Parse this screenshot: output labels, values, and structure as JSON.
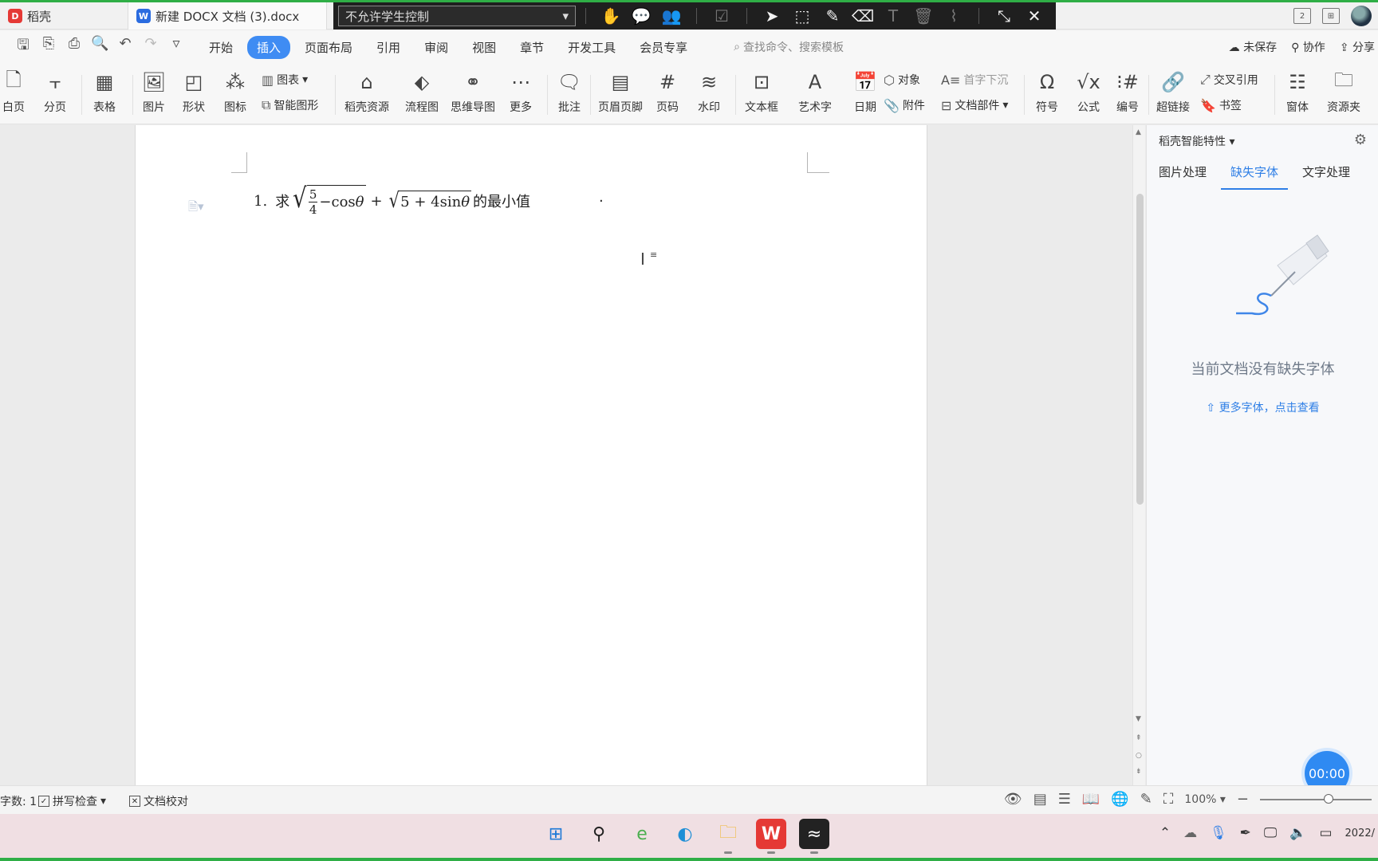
{
  "tabs": [
    {
      "label": "稻壳"
    },
    {
      "label": "新建 DOCX 文档 (3).docx"
    }
  ],
  "overlay": {
    "select_value": "不允许学生控制"
  },
  "menu": {
    "items": [
      "开始",
      "插入",
      "页面布局",
      "引用",
      "审阅",
      "视图",
      "章节",
      "开发工具",
      "会员专享"
    ],
    "active": "插入",
    "search_placeholder": "查找命令、搜索模板",
    "unsaved": "未保存",
    "collab": "协作",
    "share": "分享"
  },
  "ribbon": {
    "blank_page": "白页",
    "page_break": "分页",
    "table": "表格",
    "picture": "图片",
    "shape": "形状",
    "icon": "图标",
    "chart": "图表",
    "smart_shape": "智能图形",
    "daoke_res": "稻壳资源",
    "flowchart": "流程图",
    "mindmap": "思维导图",
    "more": "更多",
    "comment": "批注",
    "header_footer": "页眉页脚",
    "page_number": "页码",
    "watermark": "水印",
    "textbox": "文本框",
    "wordart": "艺术字",
    "date": "日期",
    "object": "对象",
    "attachment": "附件",
    "drop_cap": "首字下沉",
    "doc_parts": "文档部件",
    "symbol": "符号",
    "formula": "公式",
    "numbering": "编号",
    "hyperlink": "超链接",
    "cross_ref": "交叉引用",
    "bookmark": "书签",
    "form": "窗体",
    "resource": "资源夹"
  },
  "document": {
    "item_number": "1.",
    "prefix": "求",
    "frac_num": "5",
    "frac_den": "4",
    "term1": "−cos",
    "theta": "θ",
    "plus": "+",
    "radicand2": "5 + 4sin",
    "suffix": "的最小值",
    "trailing_dot": "."
  },
  "panel": {
    "title": "稻壳智能特性",
    "tabs": [
      "图片处理",
      "缺失字体",
      "文字处理"
    ],
    "active_tab": "缺失字体",
    "message": "当前文档没有缺失字体",
    "link": "更多字体，点击查看",
    "timer": "00:00"
  },
  "status": {
    "word_count": "字数: 1",
    "spell_check": "拼写检查",
    "doc_proof": "文档校对",
    "zoom": "100%"
  },
  "tray": {
    "clock": "2022/"
  }
}
